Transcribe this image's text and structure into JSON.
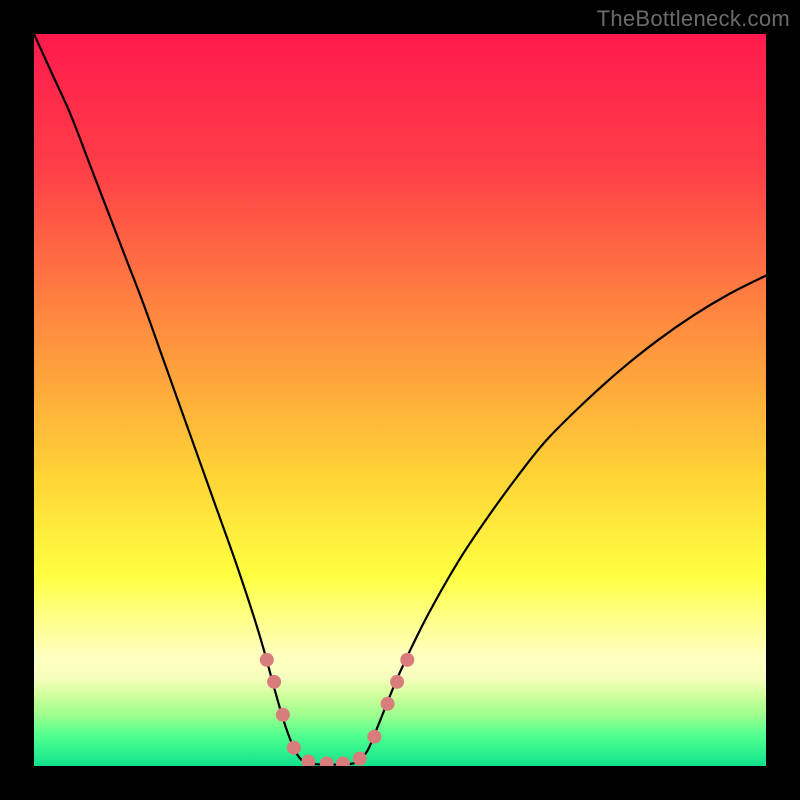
{
  "watermark": "TheBottleneck.com",
  "chart_data": {
    "type": "line",
    "title": "",
    "xlabel": "",
    "ylabel": "",
    "xlim": [
      0,
      100
    ],
    "ylim": [
      0,
      100
    ],
    "gradient_stops": [
      {
        "offset": 0,
        "color": "#ff1a4d"
      },
      {
        "offset": 18,
        "color": "#ff3d47"
      },
      {
        "offset": 38,
        "color": "#ff8640"
      },
      {
        "offset": 60,
        "color": "#ffd236"
      },
      {
        "offset": 74,
        "color": "#ffff40"
      },
      {
        "offset": 80,
        "color": "#ffff8a"
      },
      {
        "offset": 85,
        "color": "#ffffc0"
      },
      {
        "offset": 88,
        "color": "#f6ffbe"
      },
      {
        "offset": 90,
        "color": "#d6ff9e"
      },
      {
        "offset": 93,
        "color": "#9eff8e"
      },
      {
        "offset": 96,
        "color": "#4dff8e"
      },
      {
        "offset": 100,
        "color": "#11e38e"
      }
    ],
    "series": [
      {
        "name": "left-curve",
        "color": "#000000",
        "stroke_width": 2.2,
        "points": [
          {
            "x": 0.0,
            "y": 100.0
          },
          {
            "x": 2.5,
            "y": 94.5
          },
          {
            "x": 5.0,
            "y": 89.0
          },
          {
            "x": 7.5,
            "y": 82.5
          },
          {
            "x": 10.0,
            "y": 76.0
          },
          {
            "x": 12.5,
            "y": 69.5
          },
          {
            "x": 15.0,
            "y": 63.0
          },
          {
            "x": 17.5,
            "y": 56.0
          },
          {
            "x": 20.0,
            "y": 49.0
          },
          {
            "x": 22.5,
            "y": 42.0
          },
          {
            "x": 25.0,
            "y": 35.0
          },
          {
            "x": 27.5,
            "y": 28.0
          },
          {
            "x": 30.0,
            "y": 20.5
          },
          {
            "x": 31.5,
            "y": 15.5
          },
          {
            "x": 33.0,
            "y": 10.0
          },
          {
            "x": 34.5,
            "y": 5.0
          },
          {
            "x": 36.0,
            "y": 1.5
          },
          {
            "x": 37.5,
            "y": 0.4
          },
          {
            "x": 40.0,
            "y": 0.2
          },
          {
            "x": 42.0,
            "y": 0.2
          }
        ]
      },
      {
        "name": "right-curve",
        "color": "#000000",
        "stroke_width": 2.2,
        "points": [
          {
            "x": 42.0,
            "y": 0.2
          },
          {
            "x": 44.0,
            "y": 0.5
          },
          {
            "x": 45.5,
            "y": 2.0
          },
          {
            "x": 47.0,
            "y": 5.5
          },
          {
            "x": 49.0,
            "y": 10.5
          },
          {
            "x": 51.0,
            "y": 15.0
          },
          {
            "x": 54.0,
            "y": 21.0
          },
          {
            "x": 58.0,
            "y": 28.0
          },
          {
            "x": 62.0,
            "y": 34.0
          },
          {
            "x": 66.0,
            "y": 39.5
          },
          {
            "x": 70.0,
            "y": 44.5
          },
          {
            "x": 75.0,
            "y": 49.5
          },
          {
            "x": 80.0,
            "y": 54.0
          },
          {
            "x": 85.0,
            "y": 58.0
          },
          {
            "x": 90.0,
            "y": 61.5
          },
          {
            "x": 95.0,
            "y": 64.5
          },
          {
            "x": 100.0,
            "y": 67.0
          }
        ]
      }
    ],
    "markers": {
      "color": "#d97c7c",
      "radius": 7,
      "points": [
        {
          "x": 31.8,
          "y": 14.5
        },
        {
          "x": 32.8,
          "y": 11.5
        },
        {
          "x": 34.0,
          "y": 7.0
        },
        {
          "x": 35.5,
          "y": 2.5
        },
        {
          "x": 37.5,
          "y": 0.6
        },
        {
          "x": 40.0,
          "y": 0.35
        },
        {
          "x": 42.2,
          "y": 0.35
        },
        {
          "x": 44.5,
          "y": 1.0
        },
        {
          "x": 46.5,
          "y": 4.0
        },
        {
          "x": 48.3,
          "y": 8.5
        },
        {
          "x": 49.6,
          "y": 11.5
        },
        {
          "x": 51.0,
          "y": 14.5
        }
      ]
    }
  }
}
